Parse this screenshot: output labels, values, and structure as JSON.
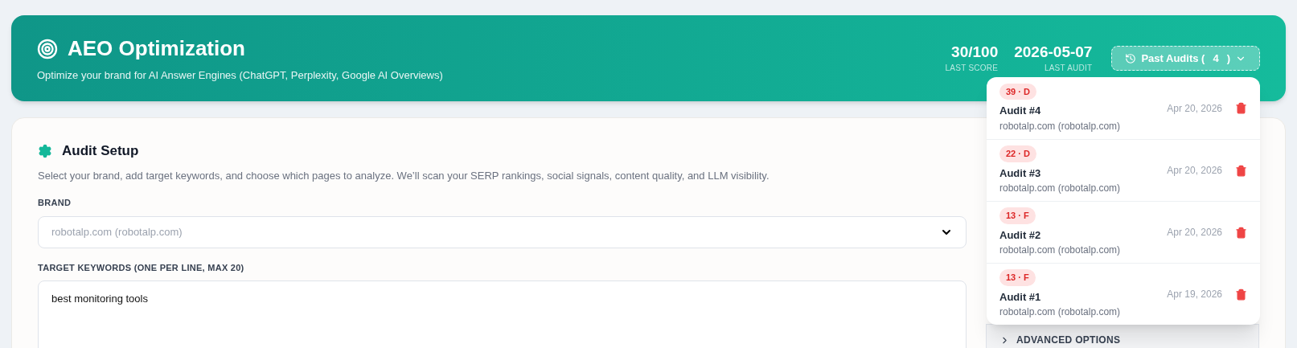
{
  "header": {
    "title": "AEO Optimization",
    "subtitle": "Optimize your brand for AI Answer Engines (ChatGPT, Perplexity, Google AI Overviews)",
    "stats": [
      {
        "value": "30/100",
        "label": "LAST SCORE"
      },
      {
        "value": "2026-05-07",
        "label": "LAST AUDIT"
      }
    ],
    "past_audits_button": {
      "label": "Past Audits (",
      "count": "4",
      "close": ")",
      "expanded": true
    }
  },
  "past_audits": [
    {
      "grade": "39 · D",
      "title": "Audit #4",
      "brand": "robotalp.com (robotalp.com)",
      "date": "Apr 20, 2026"
    },
    {
      "grade": "22 · D",
      "title": "Audit #3",
      "brand": "robotalp.com (robotalp.com)",
      "date": "Apr 20, 2026"
    },
    {
      "grade": "13 · F",
      "title": "Audit #2",
      "brand": "robotalp.com (robotalp.com)",
      "date": "Apr 20, 2026"
    },
    {
      "grade": "13 · F",
      "title": "Audit #1",
      "brand": "robotalp.com (robotalp.com)",
      "date": "Apr 19, 2026"
    }
  ],
  "audit_setup": {
    "title": "Audit Setup",
    "description": "Select your brand, add target keywords, and choose which pages to analyze. We’ll scan your SERP rankings, social signals, content quality, and LLM visibility.",
    "brand_label": "BRAND",
    "brand_value": "robotalp.com (robotalp.com)",
    "keywords_label": "TARGET KEYWORDS (ONE PER LINE, MAX 20)",
    "keywords_value": "best monitoring tools"
  },
  "side_panel": {
    "advanced_options": "ADVANCED OPTIONS",
    "expanded": false
  }
}
